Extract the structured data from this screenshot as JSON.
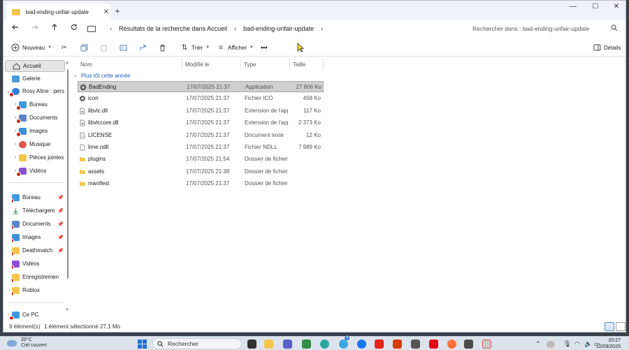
{
  "window": {
    "tab_title": "bad-ending-unfair-update",
    "tab_close": "✕",
    "new_tab": "+",
    "controls": {
      "minimize": "—",
      "maximize": "☐",
      "close": "✕"
    }
  },
  "address": {
    "breadcrumb": [
      "Résultats de la recherche dans Accueil",
      "bad-ending-unfair-update"
    ],
    "search_placeholder": "Rechercher dans : bad-ending-unfair-update"
  },
  "toolbar": {
    "new_label": "Nouveau",
    "sort_label": "Trier",
    "view_label": "Afficher",
    "more_label": "•••",
    "details_label": "Détails"
  },
  "sidebar": {
    "home": "Accueil",
    "gallery": "Galerie",
    "onedrive": "Rosy Aline : pers",
    "onedrive_children": [
      "Bureau",
      "Documents",
      "Images",
      "Musique",
      "Pièces jointes",
      "Vidéos"
    ],
    "quick_access": [
      "Bureau",
      "Téléchargem",
      "Documents",
      "Images",
      "Deathmatch",
      "Vidéos",
      "Enregistremen",
      "Roblox"
    ],
    "this_pc": "Ce PC"
  },
  "filelist": {
    "columns": {
      "name": "Nom",
      "modified": "Modifié le",
      "type": "Type",
      "size": "Taille"
    },
    "group_label": "Plus tôt cette année",
    "rows": [
      {
        "name": "BadEnding",
        "date": "17/07/2025 21:37",
        "type": "Application",
        "size": "27 806 Ko",
        "icon": "app-icon",
        "selected": true
      },
      {
        "name": "icon",
        "date": "17/07/2025 21:37",
        "type": "Fichier ICO",
        "size": "458 Ko",
        "icon": "ico-file-icon"
      },
      {
        "name": "libvlc.dll",
        "date": "17/07/2025 21:37",
        "type": "Extension de l'app...",
        "size": "117 Ko",
        "icon": "dll-file-icon"
      },
      {
        "name": "libvlccore.dll",
        "date": "17/07/2025 21:37",
        "type": "Extension de l'app...",
        "size": "2 373 Ko",
        "icon": "dll-file-icon"
      },
      {
        "name": "LICENSE",
        "date": "17/07/2025 21:37",
        "type": "Document texte",
        "size": "12 Ko",
        "icon": "text-file-icon"
      },
      {
        "name": "lime.ndll",
        "date": "17/07/2025 21:37",
        "type": "Fichier NDLL",
        "size": "7 989 Ko",
        "icon": "file-icon"
      },
      {
        "name": "plugins",
        "date": "17/07/2025 21:54",
        "type": "Dossier de fichiers",
        "size": "",
        "icon": "folder-icon"
      },
      {
        "name": "assets",
        "date": "17/07/2025 21:38",
        "type": "Dossier de fichiers",
        "size": "",
        "icon": "folder-icon"
      },
      {
        "name": "manifest",
        "date": "17/07/2025 21:37",
        "type": "Dossier de fichiers",
        "size": "",
        "icon": "folder-icon"
      }
    ]
  },
  "status": {
    "count": "9 élément(s)",
    "selection": "1 élément sélectionné  27,1 Mo"
  },
  "taskbar": {
    "temperature": "20°C",
    "condition": "Ciel couvert",
    "search_label": "Rechercher",
    "badge": "9",
    "time": "20:27",
    "date": "12/09/2025"
  },
  "colors": {
    "folder": "#f3c64b",
    "accent": "#1f6fd6",
    "selection": "#cfcfcf",
    "error": "#c42b1c"
  }
}
